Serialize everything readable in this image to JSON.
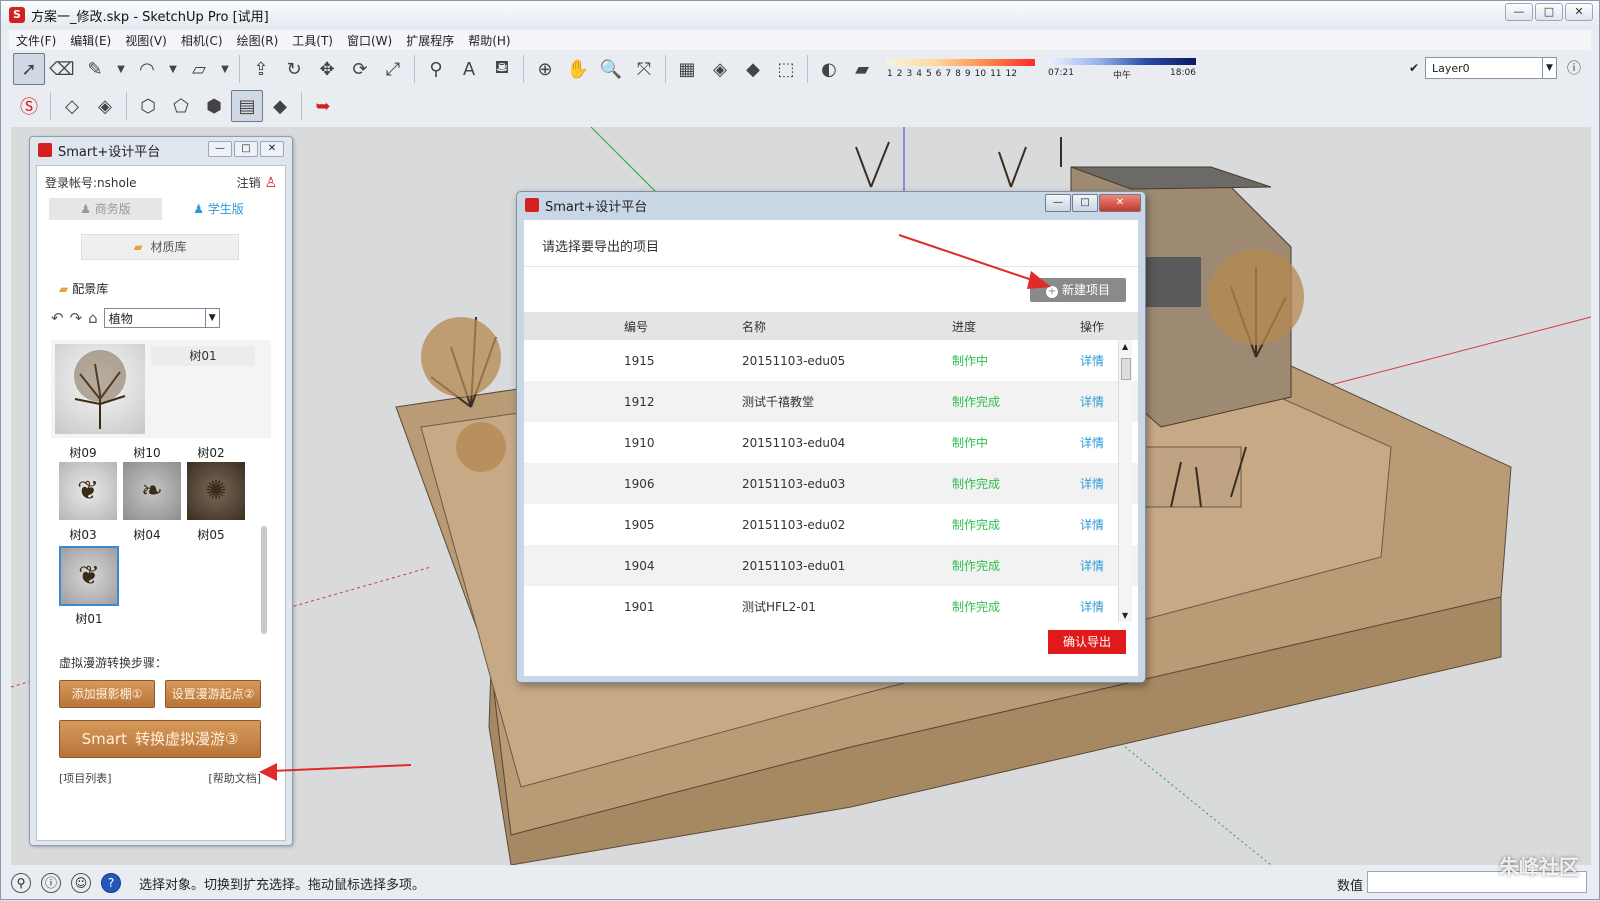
{
  "window": {
    "title": "方案一_修改.skp - SketchUp Pro [试用]"
  },
  "menu": [
    "文件(F)",
    "编辑(E)",
    "视图(V)",
    "相机(C)",
    "绘图(R)",
    "工具(T)",
    "窗口(W)",
    "扩展程序",
    "帮助(H)"
  ],
  "toolbar": {
    "shadow_numbers": [
      "1",
      "2",
      "3",
      "4",
      "5",
      "6",
      "7",
      "8",
      "9",
      "10",
      "11",
      "12"
    ],
    "time_start": "07:21",
    "time_mid": "中午",
    "time_end": "18:06",
    "layer": "Layer0"
  },
  "panel": {
    "title": "Smart+设计平台",
    "login": "登录帐号:nshole",
    "logout": "注销",
    "tab_business": "商务版",
    "tab_student": "学生版",
    "material_lib": "材质库",
    "scene_lib": "配景库",
    "category": "植物",
    "preview_name": "树01",
    "row1_labels": [
      "树09",
      "树10",
      "树02"
    ],
    "row2_labels": [
      "树03",
      "树04",
      "树05"
    ],
    "selected_label": "树01",
    "steps_label": "虚拟漫游转换步骤：",
    "btn_add_camera": "添加摄影棚①",
    "btn_set_start": "设置漫游起点②",
    "btn_convert_logo": "Smart",
    "btn_convert": "转换虚拟漫游③",
    "link_projects": "[项目列表]",
    "link_help": "[帮助文档]"
  },
  "dialog": {
    "title": "Smart+设计平台",
    "heading": "请选择要导出的项目",
    "new_project": "新建项目",
    "columns": [
      "编号",
      "名称",
      "进度",
      "操作"
    ],
    "rows": [
      {
        "id": "1915",
        "name": "20151103-edu05",
        "status": "制作中",
        "action": "详情"
      },
      {
        "id": "1912",
        "name": "测试千禧教堂",
        "status": "制作完成",
        "action": "详情"
      },
      {
        "id": "1910",
        "name": "20151103-edu04",
        "status": "制作中",
        "action": "详情"
      },
      {
        "id": "1906",
        "name": "20151103-edu03",
        "status": "制作完成",
        "action": "详情"
      },
      {
        "id": "1905",
        "name": "20151103-edu02",
        "status": "制作完成",
        "action": "详情"
      },
      {
        "id": "1904",
        "name": "20151103-edu01",
        "status": "制作完成",
        "action": "详情"
      },
      {
        "id": "1901",
        "name": "测试HFL2-01",
        "status": "制作完成",
        "action": "详情"
      }
    ],
    "confirm": "确认导出"
  },
  "statusbar": {
    "text": "选择对象。切换到扩充选择。拖动鼠标选择多项。",
    "measure_label": "数值"
  },
  "watermark": "朱峰社区",
  "colors": {
    "accent_red": "#e01a1a",
    "status_green": "#2fbf4f",
    "link_blue": "#2f9ad8",
    "wood": "#c98a4e",
    "ground": "#b89a74"
  }
}
